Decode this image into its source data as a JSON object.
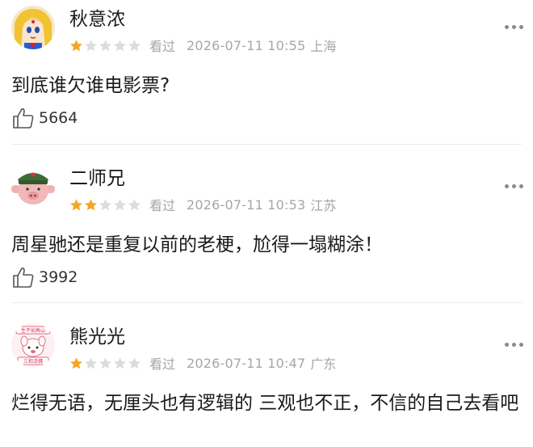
{
  "reviews": [
    {
      "user": "秋意浓",
      "rating": 1,
      "status": "看过",
      "datetime": "2026-07-11 10:55",
      "location": "上海",
      "content": "到底谁欠谁电影票?",
      "likes": "5664"
    },
    {
      "user": "二师兄",
      "rating": 2,
      "status": "看过",
      "datetime": "2026-07-11 10:53",
      "location": "江苏",
      "content": "周星驰还是重复以前的老梗，尬得一塌糊涂！",
      "likes": "3992"
    },
    {
      "user": "熊光光",
      "rating": 1,
      "status": "看过",
      "datetime": "2026-07-11 10:47",
      "location": "广东",
      "content": "烂得无语，无厘头也有逻辑的 三观也不正，不信的自己去看吧"
    }
  ],
  "colors": {
    "star_filled": "#f5a623",
    "star_empty": "#dcdcdc",
    "meta": "#a6a6a6"
  }
}
